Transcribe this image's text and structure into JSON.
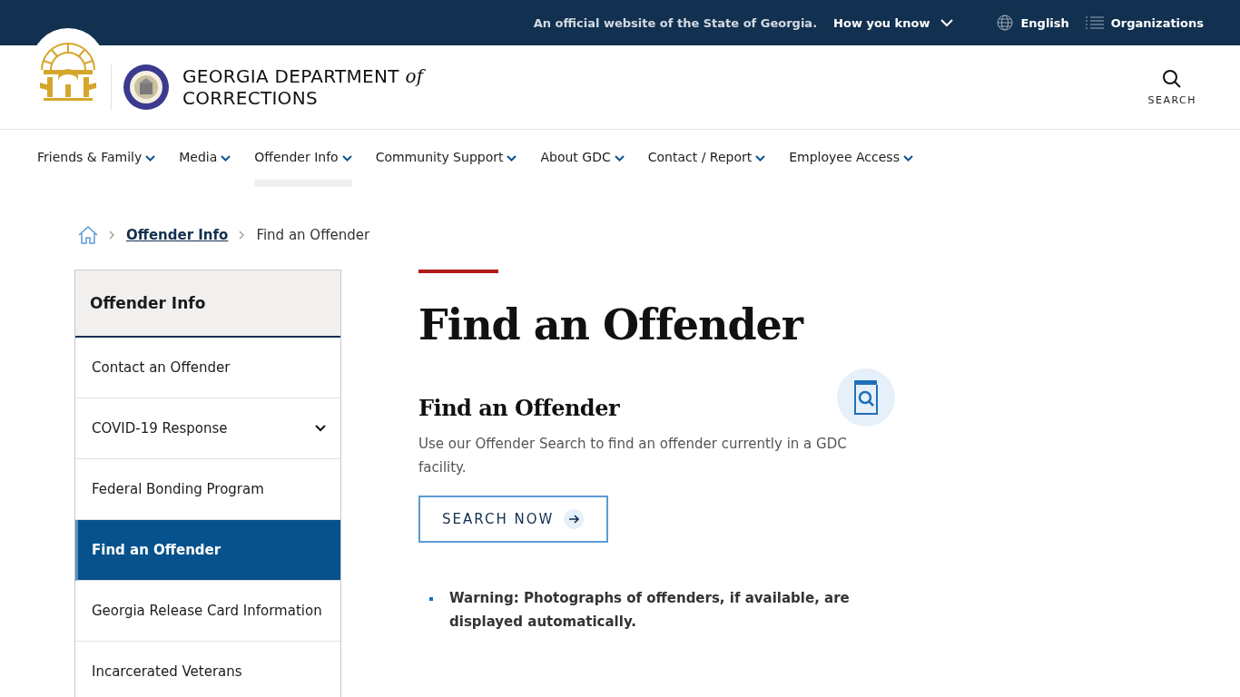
{
  "utility_bar": {
    "notice": "An official website of the State of Georgia.",
    "how_you_know": "How you know",
    "language": "English",
    "organizations": "Organizations"
  },
  "header": {
    "title_line1": "GEORGIA DEPARTMENT",
    "title_italic": "of",
    "title_line2": "CORRECTIONS",
    "search_label": "SEARCH"
  },
  "nav": [
    {
      "label": "Friends & Family",
      "selected": false
    },
    {
      "label": "Media",
      "selected": false
    },
    {
      "label": "Offender Info",
      "selected": true
    },
    {
      "label": "Community Support",
      "selected": false
    },
    {
      "label": "About GDC",
      "selected": false
    },
    {
      "label": "Contact / Report",
      "selected": false
    },
    {
      "label": "Employee Access",
      "selected": false
    }
  ],
  "breadcrumb": [
    {
      "label": "Offender Info",
      "kind": "link"
    },
    {
      "label": "Find an Offender",
      "kind": "current"
    }
  ],
  "sidebar": {
    "heading": "Offender Info",
    "items": [
      {
        "label": "Contact an Offender",
        "selected": false,
        "kind": "link"
      },
      {
        "label": "COVID-19 Response",
        "selected": false,
        "kind": "expandable"
      },
      {
        "label": "Federal Bonding Program",
        "selected": false,
        "kind": "link"
      },
      {
        "label": "Find an Offender",
        "selected": true,
        "kind": "link"
      },
      {
        "label": "Georgia Release Card Information",
        "selected": false,
        "kind": "link"
      },
      {
        "label": "Incarcerated Veterans",
        "selected": false,
        "kind": "link"
      }
    ]
  },
  "main": {
    "page_title": "Find an Offender",
    "section_title": "Find an Offender",
    "description": "Use our Offender Search to find an offender currently in a GDC facility.",
    "button": "SEARCH NOW",
    "notes": [
      "Warning: Photographs of offenders, if available, are displayed automatically."
    ]
  }
}
